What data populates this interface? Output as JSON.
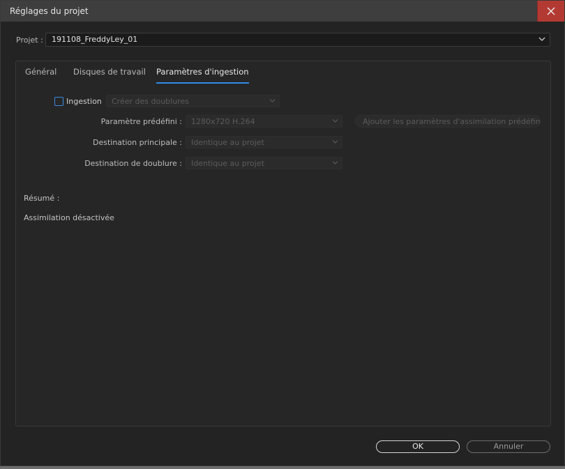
{
  "window": {
    "title": "Réglages du projet"
  },
  "project": {
    "label": "Projet :",
    "value": "191108_FreddyLey_01"
  },
  "tabs": [
    {
      "label": "Général"
    },
    {
      "label": "Disques de travail"
    },
    {
      "label": "Paramètres d'ingestion",
      "active": true
    }
  ],
  "ingest": {
    "checkbox_label": "Ingestion",
    "checked": false,
    "mode_value": "Créer des doublures",
    "preset_label": "Paramètre prédéfini :",
    "preset_value": "1280x720 H.264",
    "add_preset_button": "Ajouter les paramètres d'assimilation prédéfinis...",
    "primary_dest_label": "Destination principale :",
    "primary_dest_value": "Identique au projet",
    "proxy_dest_label": "Destination de doublure :",
    "proxy_dest_value": "Identique au projet"
  },
  "summary": {
    "label": "Résumé :",
    "text": "Assimilation désactivée"
  },
  "footer": {
    "ok_label": "OK",
    "cancel_label": "Annuler"
  },
  "colors": {
    "accent": "#2d8ceb",
    "close": "#b33a33",
    "background": "#232323"
  }
}
